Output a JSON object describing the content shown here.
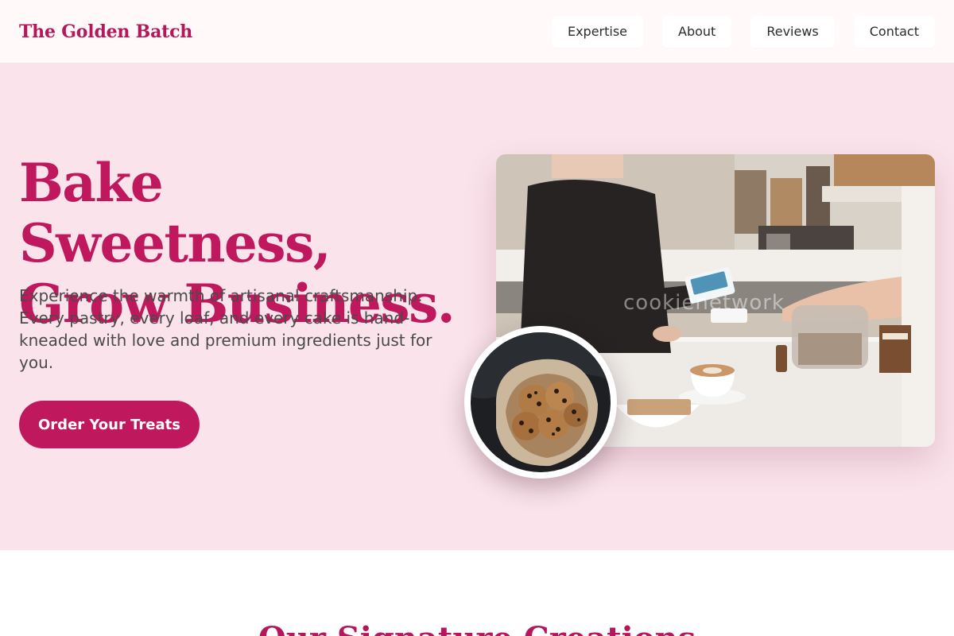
{
  "brand": {
    "name": "The Golden Batch"
  },
  "nav": {
    "items": [
      {
        "label": "Expertise"
      },
      {
        "label": "About"
      },
      {
        "label": "Reviews"
      },
      {
        "label": "Contact"
      }
    ]
  },
  "hero": {
    "title_line1": "Bake Sweetness,",
    "title_line2": "Grow Business.",
    "description": "Experience the warmth of artisanal craftsmanship. Every pastry, every loaf, and every cake is hand-kneaded with love and premium ingredients just for you.",
    "cta_label": "Order Your Treats",
    "photo_watermark": "cookienetwork"
  },
  "next_section": {
    "title": "Our Signature Creations"
  },
  "colors": {
    "brand": "#b5175a",
    "accent": "#c0185c",
    "hero_background": "#fae3eb",
    "header_background": "#fff9fa"
  },
  "icons": {
    "hero_photo": "cafe-counter-payment-photo",
    "circle_photo": "cookies-basket-photo"
  }
}
